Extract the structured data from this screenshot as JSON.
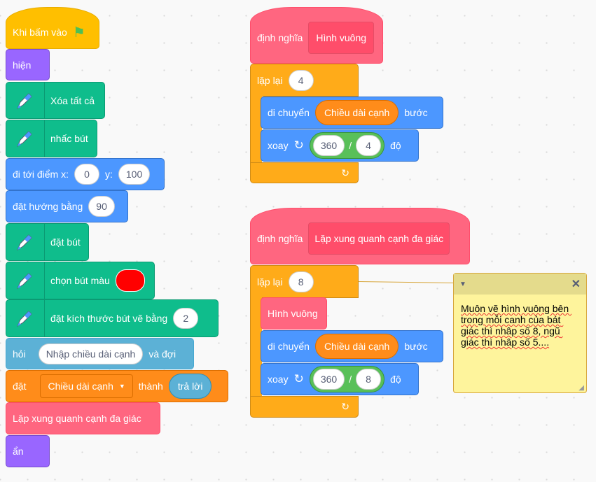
{
  "main_script": {
    "when_flag": "Khi bấm vào",
    "show": "hiện",
    "clear": "Xóa tất cả",
    "pen_up": "nhấc bút",
    "goto_label": "đi tới điểm x:",
    "goto_y_label": "y:",
    "goto_x": "0",
    "goto_y": "100",
    "point_label": "đặt hướng bằng",
    "point_value": "90",
    "pen_down": "đặt bút",
    "pen_color_label": "chọn bút màu",
    "pen_color": "#FF0000",
    "pen_size_label": "đặt kích thước bút vẽ bằng",
    "pen_size": "2",
    "ask_label": "hỏi",
    "ask_value": "Nhập chiều dài cạnh",
    "ask_wait": "và đợi",
    "set_label": "đặt",
    "set_var": "Chiều dài cạnh",
    "set_to": "thành",
    "answer": "trả lời",
    "call": "Lặp xung quanh cạnh đa giác",
    "hide": "ẩn"
  },
  "define_square": {
    "define": "định nghĩa",
    "name": "Hình vuông",
    "repeat": "lặp lại",
    "repeat_count": "4",
    "move": "di chuyển",
    "move_var": "Chiều dài cạnh",
    "steps": "bước",
    "turn": "xoay",
    "turn_a": "360",
    "div": "/",
    "turn_b": "4",
    "deg": "độ"
  },
  "define_polygon": {
    "define": "định nghĩa",
    "name": "Lặp xung quanh cạnh đa giác",
    "repeat": "lặp lại",
    "repeat_count": "8",
    "call": "Hình vuông",
    "move": "di chuyển",
    "move_var": "Chiều dài cạnh",
    "steps": "bước",
    "turn": "xoay",
    "turn_a": "360",
    "div": "/",
    "turn_b": "8",
    "deg": "độ"
  },
  "comment": {
    "text": "Muôn vẽ hình vuông bên trong mỗi canh của bát giác thì nhâp số 8, ngũ giác thì nhâp số 5...."
  }
}
